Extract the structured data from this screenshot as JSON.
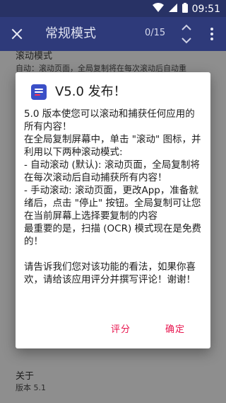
{
  "status_bar": {
    "time": "09:51"
  },
  "app_bar": {
    "title": "常规模式",
    "counter": "0/15"
  },
  "background_list": {
    "row1_title": "滚动模式",
    "row1_subtitle": "自动：滚动页面，全局复制将在每次滚动后自动重",
    "row2_title": "关于",
    "row2_subtitle": "版本 5.1"
  },
  "dialog": {
    "title": "V5.0 发布！",
    "body": "5.0 版本使您可以滚动和捕获任何应用的所有内容！\n在全局复制屏幕中，单击 \"滚动\" 图标，并利用以下两种滚动模式:\n- 自动滚动 (默认): 滚动页面，全局复制将在每次滚动后自动捕获所有内容！\n- 手动滚动: 滚动页面，更改App，准备就绪后，点击 \"停止\" 按钮。全局复制可让您在当前屏幕上选择要复制的内容\n最重要的是，扫描 (OCR) 模式现在是免费的！\n\n请告诉我们您对该功能的看法，如果你喜欢，请给该应用评分并撰写评论！谢谢！",
    "rate_label": "评分",
    "ok_label": "确定"
  },
  "colors": {
    "status_bar": "#283265",
    "app_bar": "#2e3a7a",
    "accent": "#e8134d",
    "icon_bg": "#3a4fc7"
  }
}
